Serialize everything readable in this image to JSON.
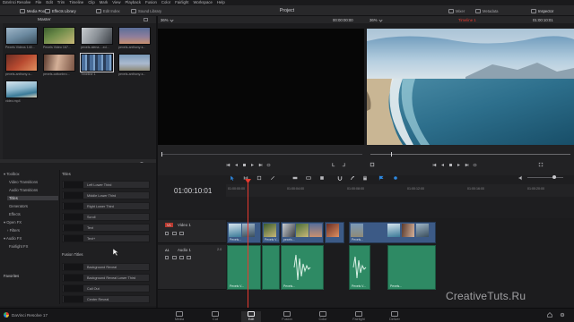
{
  "menu": [
    "DaVinci Resolve",
    "File",
    "Edit",
    "Trim",
    "Timeline",
    "Clip",
    "Mark",
    "View",
    "Playback",
    "Fusion",
    "Color",
    "Fairlight",
    "Workspace",
    "Help"
  ],
  "header": {
    "media_pool": "Media Pool",
    "effects_library": "Effects Library",
    "edit_index": "Edit Index",
    "sound_library": "Sound Library",
    "project_title": "Project",
    "mixer": "Mixer",
    "metadata": "Metadata",
    "inspector": "Inspector"
  },
  "media_pool": {
    "title": "Master",
    "clips": [
      {
        "label": "Pexels Videos 140..."
      },
      {
        "label": "Pexels Video 167..."
      },
      {
        "label": "pexels-alena-...ed..."
      },
      {
        "label": "pexels-anthony-s..."
      },
      {
        "label": "pexels-anthony-s..."
      },
      {
        "label": "pexels-cottonbro..."
      },
      {
        "label": "Timeline 1"
      },
      {
        "label": "pexels-anthony-s..."
      },
      {
        "label": "video.mp4"
      }
    ]
  },
  "viewer": {
    "src_zoom": "36%",
    "src_tc": "00:00:00:00",
    "rec_zoom": "36%",
    "timeline_name": "Timeline 1",
    "rec_tc": "01:00:10:01"
  },
  "effects": {
    "tree": [
      "Toolbox",
      "Video Transitions",
      "Audio Transitions",
      "Titles",
      "Generators",
      "Effects",
      "Open FX",
      "Filters",
      "Audio FX",
      "Fairlight FX"
    ],
    "favorites": "Favorites",
    "titles_header": "Titles",
    "titles": [
      "Left Lower Third",
      "Middle Lower Third",
      "Right Lower Third",
      "Scroll",
      "Text",
      "Text+"
    ],
    "fusion_header": "Fusion Titles",
    "fusion_titles": [
      "Background Reveal",
      "Background Reveal Lower Third",
      "Call Out",
      "Center Reveal"
    ]
  },
  "timeline": {
    "timecode": "01:00:10:01",
    "ruler": [
      "01:00:00:00",
      "01:00:04:00",
      "01:00:08:00",
      "01:00:12:00",
      "01:00:16:00",
      "01:00:20:00",
      "01:00:24:00"
    ],
    "video_track_id": "V1",
    "video_track": "Video 1",
    "audio_track_id": "A1",
    "audio_track": "Audio 1",
    "audio_channels": "2.0",
    "video_clips": [
      "Pexels...",
      "Pexels V...",
      "pexels...",
      "Pexels..."
    ],
    "audio_clips": [
      "Pexels V...",
      "Pexels...",
      "Pexels V...",
      "Pexels..."
    ]
  },
  "pages": [
    "Media",
    "Cut",
    "Edit",
    "Fusion",
    "Color",
    "Fairlight",
    "Deliver"
  ],
  "active_page": "Edit",
  "footer_app": "DaVinci Resolve 17",
  "watermark": "CreativeTuts.Ru",
  "colors": {
    "accent": "#e8392f",
    "video_clip": "#3c5a86",
    "audio_clip": "#2e8a64"
  }
}
